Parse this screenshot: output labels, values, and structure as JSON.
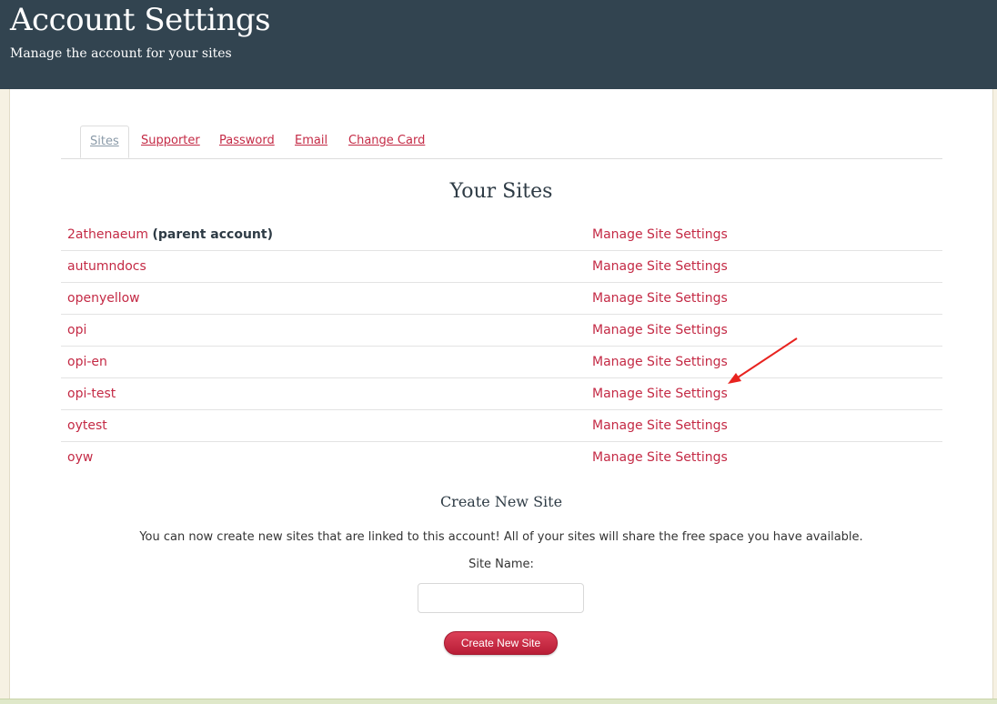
{
  "header": {
    "title": "Account Settings",
    "subtitle": "Manage the account for your sites"
  },
  "tabs": [
    {
      "label": "Sites",
      "active": true
    },
    {
      "label": "Supporter",
      "active": false
    },
    {
      "label": "Password",
      "active": false
    },
    {
      "label": "Email",
      "active": false
    },
    {
      "label": "Change Card",
      "active": false
    }
  ],
  "sites": {
    "title": "Your Sites",
    "parent_label": "(parent account)",
    "rows": [
      {
        "name": "2athenaeum",
        "action": "Manage Site Settings"
      },
      {
        "name": "autumndocs",
        "action": "Manage Site Settings"
      },
      {
        "name": "openyellow",
        "action": "Manage Site Settings"
      },
      {
        "name": "opi",
        "action": "Manage Site Settings"
      },
      {
        "name": "opi-en",
        "action": "Manage Site Settings"
      },
      {
        "name": "opi-test",
        "action": "Manage Site Settings"
      },
      {
        "name": "oytest",
        "action": "Manage Site Settings"
      },
      {
        "name": "oyw",
        "action": "Manage Site Settings"
      }
    ]
  },
  "create": {
    "title": "Create New Site",
    "description": "You can now create new sites that are linked to this account! All of your sites will share the free space you have available.",
    "field_label": "Site Name:",
    "input_value": "",
    "button_label": "Create New Site"
  },
  "colors": {
    "header_bg": "#324450",
    "link": "#c42a45",
    "annotation_arrow": "#e8231f"
  }
}
